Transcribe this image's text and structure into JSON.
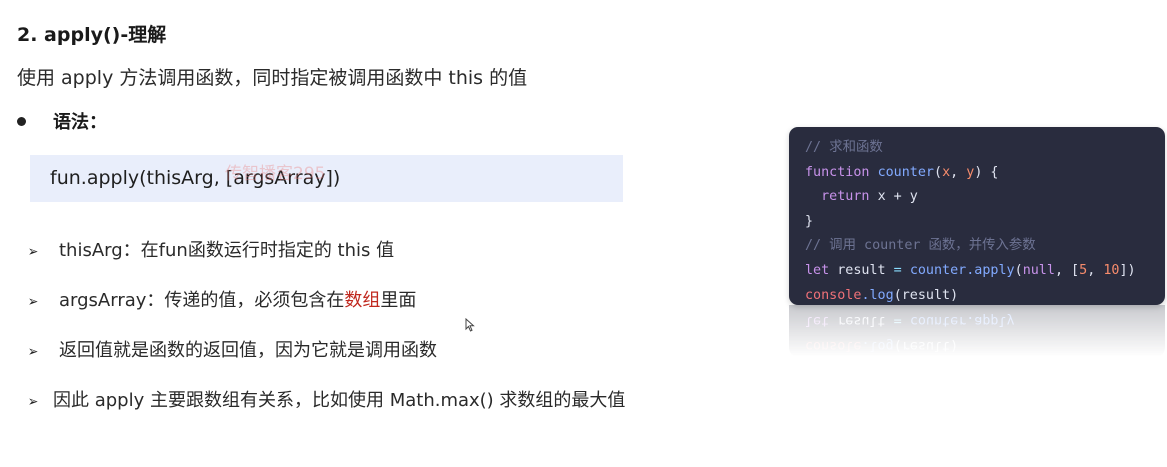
{
  "heading": "2. apply()-理解",
  "intro": "使用 apply 方法调用函数，同时指定被调用函数中 this 的值",
  "syntax": {
    "label": "语法：",
    "code": "fun.apply(thisArg, [argsArray])",
    "watermark": "传智播客295"
  },
  "points": [
    {
      "text": "thisArg：在fun函数运行时指定的 this 值"
    },
    {
      "text_before": "argsArray：传递的值，必须包含在",
      "highlight": "数组",
      "text_after": "里面"
    },
    {
      "text": "返回值就是函数的返回值，因为它就是调用函数"
    },
    {
      "text": "因此 apply 主要跟数组有关系，比如使用 Math.max() 求数组的最大值"
    }
  ],
  "code_example": {
    "comment1": "// 求和函数",
    "kw_function": "function",
    "fn_counter": "counter",
    "params_open": "(",
    "param_x": "x",
    "comma": ", ",
    "param_y": "y",
    "params_close": ") {",
    "kw_return": "return",
    "return_expr": "x + y",
    "close_brace": "}",
    "comment2": "// 调用 counter 函数，并传入参数",
    "kw_let": "let",
    "var_result": "result",
    "assign": " = ",
    "call_obj": "counter",
    "call_method": ".apply",
    "call_args_open": "(",
    "arg_null": "null",
    "arg_sep": ", [",
    "num_5": "5",
    "num_sep": ", ",
    "num_10": "10",
    "call_args_close": "])",
    "console": "console",
    "log": ".log",
    "log_args": "(result)"
  },
  "colors": {
    "code_box_bg": "#e9eefb",
    "card_bg": "#292c3e",
    "highlight_red": "#c0281e"
  }
}
